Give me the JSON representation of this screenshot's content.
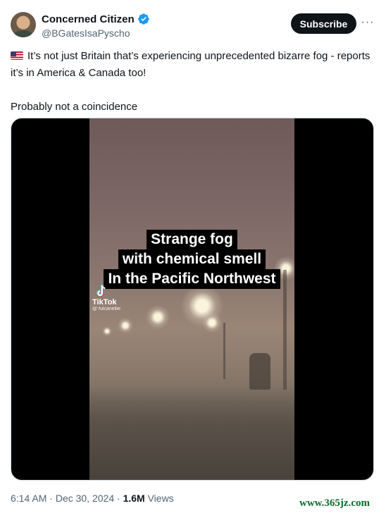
{
  "author": {
    "display_name": "Concerned Citizen",
    "handle": "@BGatesIsaPyscho",
    "verified_badge_icon": "verified-badge-icon",
    "verified_color": "#1d9bf0"
  },
  "header": {
    "subscribe_label": "Subscribe",
    "more_label": "···"
  },
  "post": {
    "flag_icon": "us-flag-icon",
    "line1": "It’s not just Britain that’s experiencing unprecedented bizarre fog - reports it’s in America & Canada too!",
    "line2": "Probably not a coincidence"
  },
  "media": {
    "caption_lines": [
      "Strange fog",
      "with chemical smell",
      "In the Pacific Northwest"
    ],
    "tiktok_name": "TikTok",
    "tiktok_handle": "@ fulcanellie"
  },
  "meta": {
    "time": "6:14 AM",
    "date": "Dec 30, 2024",
    "separator": "·",
    "views_count": "1.6M",
    "views_label": "Views"
  },
  "watermark": "www.365jz.com"
}
